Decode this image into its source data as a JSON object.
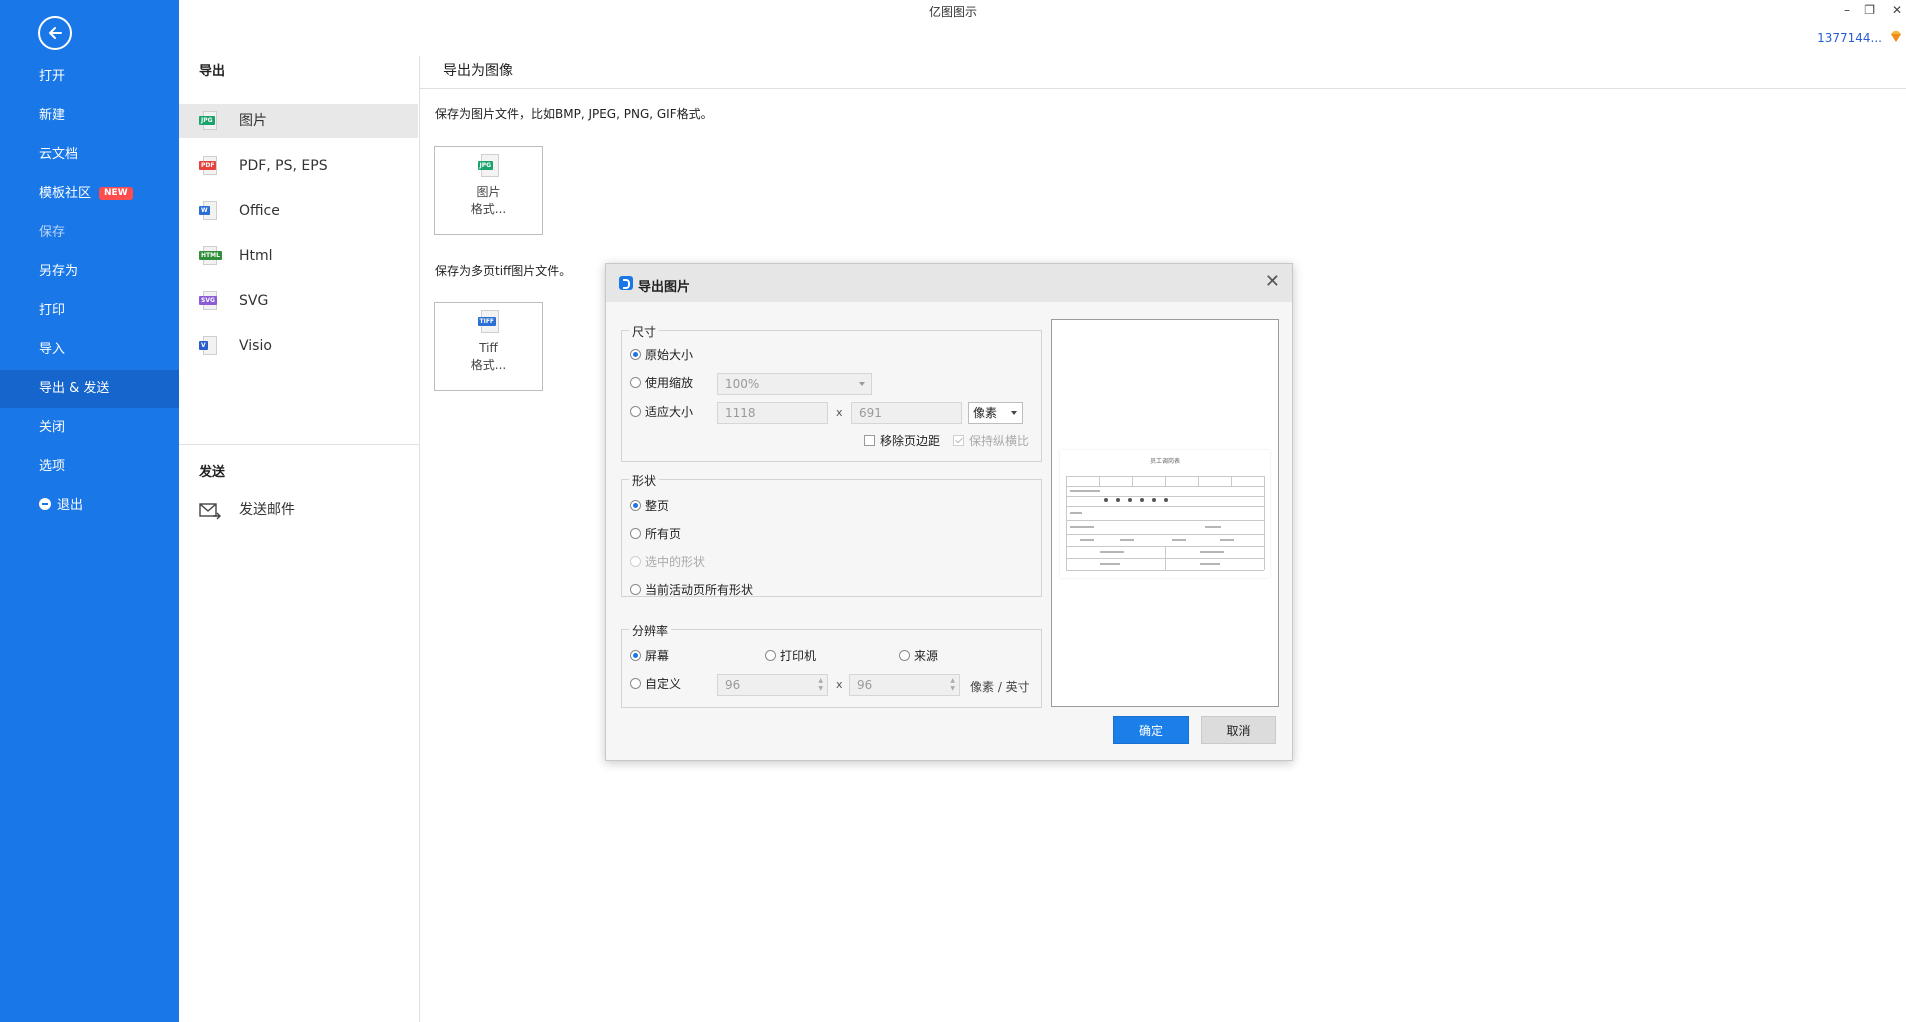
{
  "app": {
    "title": "亿图图示",
    "user": "1377144...",
    "minimize": "–",
    "restore": "❐",
    "close": "✕"
  },
  "sidebar": {
    "items": [
      {
        "label": "打开"
      },
      {
        "label": "新建"
      },
      {
        "label": "云文档"
      },
      {
        "label": "模板社区",
        "badge": "NEW"
      },
      {
        "label": "保存"
      },
      {
        "label": "另存为"
      },
      {
        "label": "打印"
      },
      {
        "label": "导入"
      },
      {
        "label": "导出 & 发送"
      },
      {
        "label": "关闭"
      },
      {
        "label": "选项"
      },
      {
        "label": "退出"
      }
    ]
  },
  "export_panel": {
    "heading": "导出",
    "items": [
      {
        "label": "图片",
        "tag": "JPG",
        "color": "#1aa36a"
      },
      {
        "label": "PDF, PS, EPS",
        "tag": "PDF",
        "color": "#e8413a"
      },
      {
        "label": "Office",
        "tag": "W",
        "color": "#2b6fd6"
      },
      {
        "label": "Html",
        "tag": "HTML",
        "color": "#2f8f3a"
      },
      {
        "label": "SVG",
        "tag": "SVG",
        "color": "#8a5cd6"
      },
      {
        "label": "Visio",
        "tag": "V",
        "color": "#2b5fcf"
      }
    ],
    "send_heading": "发送",
    "send_items": [
      {
        "label": "发送邮件"
      }
    ]
  },
  "content": {
    "heading": "导出为图像",
    "image_desc": "保存为图片文件，比如BMP, JPEG, PNG, GIF格式。",
    "image_card": {
      "tag": "JPG",
      "line1": "图片",
      "line2": "格式..."
    },
    "tiff_desc": "保存为多页tiff图片文件。",
    "tiff_card": {
      "tag": "TIFF",
      "line1": "Tiff",
      "line2": "格式..."
    }
  },
  "dialog": {
    "title": "导出图片",
    "close": "✕",
    "size_group": {
      "title": "尺寸",
      "original": "原始大小",
      "zoom": "使用缩放",
      "zoom_value": "100%",
      "fit": "适应大小",
      "width": "1118",
      "height": "691",
      "times": "x",
      "unit": "像素",
      "remove_margin": "移除页边距",
      "keep_ratio": "保持纵横比"
    },
    "shape_group": {
      "title": "形状",
      "whole_page": "整页",
      "all_pages": "所有页",
      "selected": "选中的形状",
      "active_page_shapes": "当前活动页所有形状"
    },
    "resolution_group": {
      "title": "分辨率",
      "screen": "屏幕",
      "printer": "打印机",
      "source": "来源",
      "custom": "自定义",
      "dpi_x": "96",
      "dpi_y": "96",
      "times": "x",
      "unit": "像素 / 英寸"
    },
    "preview_title": "员工调岗表",
    "ok": "确定",
    "cancel": "取消"
  }
}
